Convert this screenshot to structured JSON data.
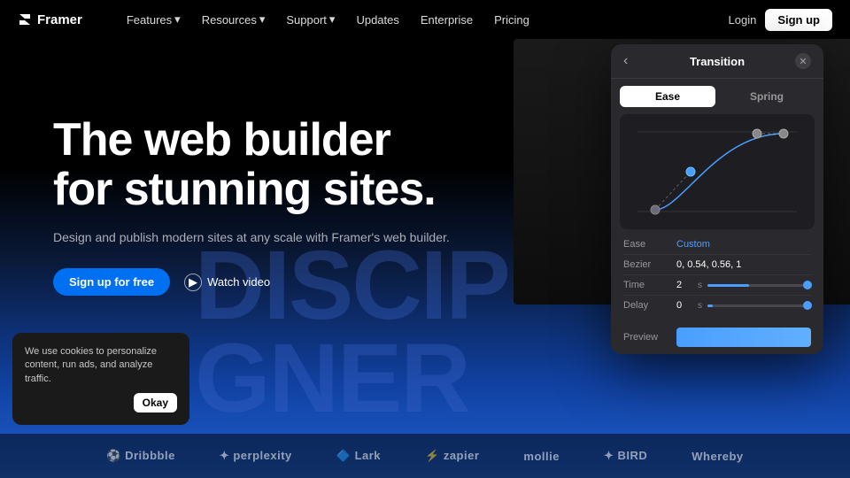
{
  "nav": {
    "logo_text": "Framer",
    "links": [
      {
        "label": "Features",
        "has_dropdown": true
      },
      {
        "label": "Resources",
        "has_dropdown": true
      },
      {
        "label": "Support",
        "has_dropdown": true
      },
      {
        "label": "Updates",
        "has_dropdown": false
      },
      {
        "label": "Enterprise",
        "has_dropdown": false
      },
      {
        "label": "Pricing",
        "has_dropdown": false
      }
    ],
    "login_label": "Login",
    "signup_label": "Sign up"
  },
  "hero": {
    "headline_line1": "The web builder",
    "headline_line2": "for stunning sites.",
    "subtext": "Design and publish modern sites at any scale with Framer's web builder.",
    "cta_primary": "Sign up for free",
    "cta_secondary": "Watch video"
  },
  "bg_text_line1": "DISCIP",
  "bg_text_line2": "GNER",
  "transition_modal": {
    "title": "Transition",
    "tab_ease": "Ease",
    "tab_spring": "Spring",
    "ease_label": "Ease",
    "ease_value": "Custom",
    "bezier_label": "Bezier",
    "bezier_value": "0, 0.54, 0.56, 1",
    "time_label": "Time",
    "time_value": "2",
    "time_unit": "s",
    "time_fill_pct": 40,
    "delay_label": "Delay",
    "delay_value": "0",
    "delay_unit": "s",
    "delay_fill_pct": 5,
    "preview_label": "Preview"
  },
  "cookie": {
    "text": "We use cookies to personalize content, run ads, and analyze traffic.",
    "button": "Okay"
  },
  "partners": [
    {
      "name": "Dribbble",
      "icon": "🏀"
    },
    {
      "name": "Perplexity"
    },
    {
      "name": "Lark"
    },
    {
      "name": "zapier"
    },
    {
      "name": "mollie"
    },
    {
      "name": "BIRD"
    },
    {
      "name": "Whereby"
    }
  ]
}
